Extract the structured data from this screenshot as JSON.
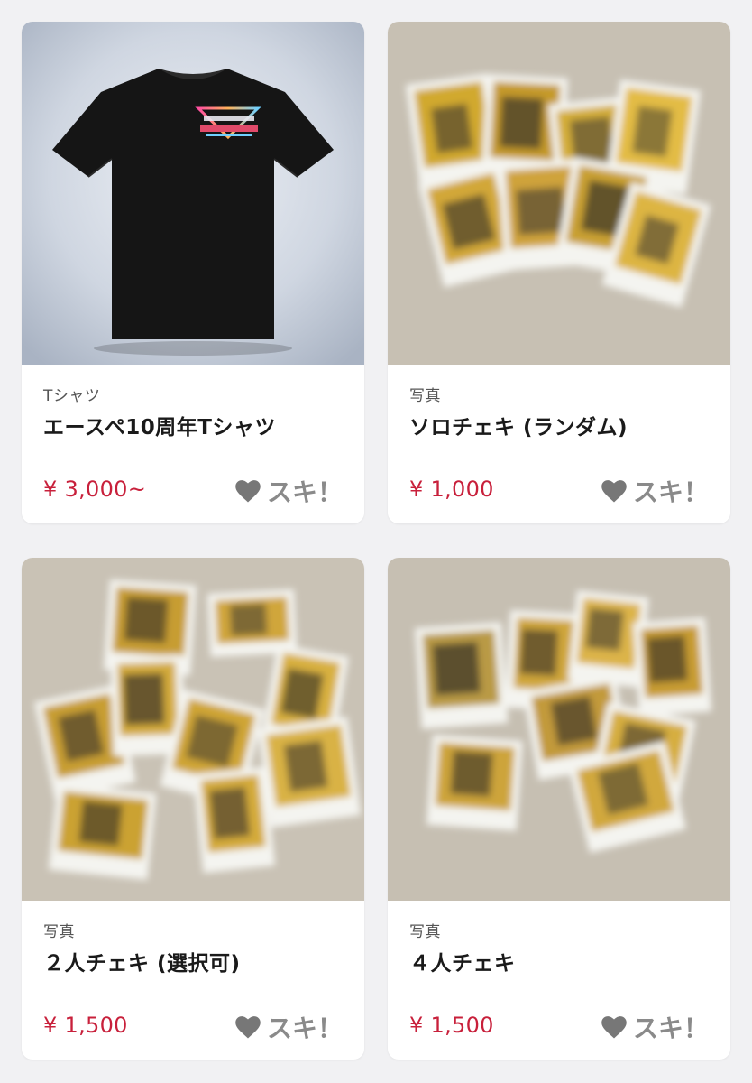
{
  "items": [
    {
      "category": "Tシャツ",
      "title": "エースペ10周年Tシャツ",
      "price": "¥ 3,000~",
      "like_label": "スキ！",
      "image": "black-tshirt-photo"
    },
    {
      "category": "写真",
      "title": "ソロチェキ (ランダム)",
      "price": "¥ 1,000",
      "like_label": "スキ！",
      "image": "blurred-instant-photos"
    },
    {
      "category": "写真",
      "title": "２人チェキ (選択可)",
      "price": "¥ 1,500",
      "like_label": "スキ！",
      "image": "blurred-instant-photos"
    },
    {
      "category": "写真",
      "title": "４人チェキ",
      "price": "¥ 1,500",
      "like_label": "スキ！",
      "image": "blurred-instant-photos"
    }
  ],
  "colors": {
    "price": "#c8203b",
    "like": "#8a8a8a",
    "background": "#f1f1f3"
  }
}
